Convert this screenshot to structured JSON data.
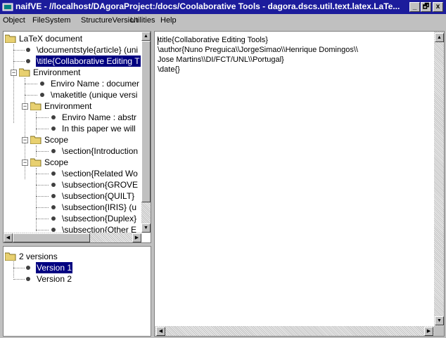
{
  "window": {
    "title": "naifVE - //localhost/DAgoraProject:/docs/Coolaborative Tools - dagora.dscs.util.text.latex.LaTe...",
    "buttons": [
      "_",
      "🗗",
      "x"
    ]
  },
  "menubar": [
    "Object",
    "FileSystem",
    "StructureVersion",
    "Utilities",
    "Help"
  ],
  "tree": {
    "nodes": [
      "LaTeX document",
      "\\documentstyle{article} (uni",
      "\\title{Collaborative Editing T",
      "Environment",
      "Enviro Name : documer",
      "\\maketitle (unique versi",
      "Environment",
      "Enviro Name : abstr",
      "In this paper we will",
      "Scope",
      "\\section{Introduction",
      "Scope",
      "\\section{Related Wo",
      "\\subsection{GROVE",
      "\\subsection{QUILT}",
      "\\subsection{IRIS} (u",
      "\\subsection{Duplex}",
      "\\subsection{Other E"
    ]
  },
  "versions": {
    "root": "2 versions",
    "items": [
      "Version 1",
      "Version 2"
    ]
  },
  "editor": {
    "lines": [
      "\\title{Collaborative Editing Tools}",
      "\\author{Nuno Preguica\\\\JorgeSimao\\\\Henrique Domingos\\\\",
      "Jose Martins\\\\DI/FCT/UNL\\\\Portugal}",
      "\\date{}"
    ]
  }
}
